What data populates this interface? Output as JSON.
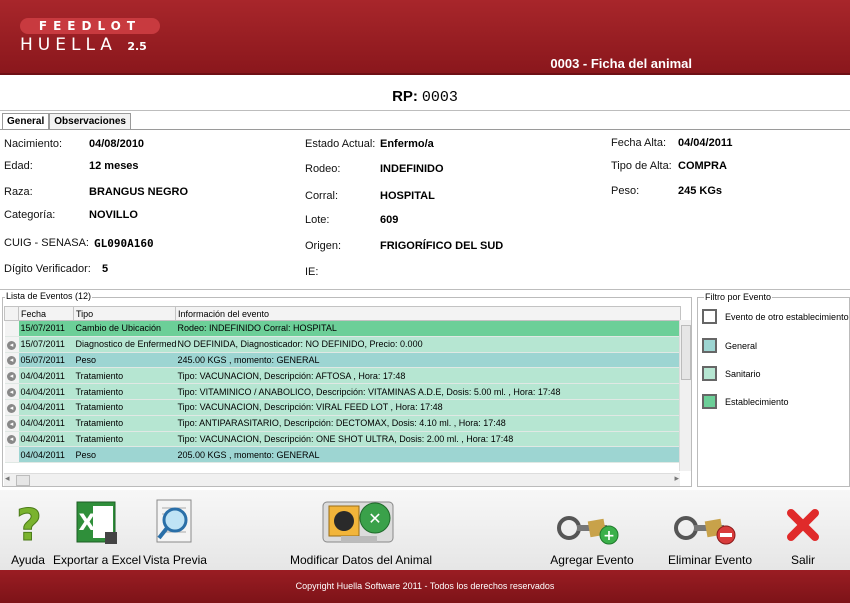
{
  "app": {
    "logo_top": "FEEDLOT",
    "logo_bottom": "HUELLA",
    "logo_version": "2.5",
    "window_title": "0003  -  Ficha del animal"
  },
  "rp": {
    "label": "RP:",
    "value": "0003"
  },
  "tabs": [
    {
      "label": "General",
      "active": true
    },
    {
      "label": "Observaciones",
      "active": false
    }
  ],
  "general": {
    "nacimiento": {
      "label": "Nacimiento:",
      "value": "04/08/2010"
    },
    "edad": {
      "label": "Edad:",
      "value": "12 meses"
    },
    "raza": {
      "label": "Raza:",
      "value": "BRANGUS NEGRO"
    },
    "categoria": {
      "label": "Categoría:",
      "value": "NOVILLO"
    },
    "cuig": {
      "label": "CUIG - SENASA:",
      "value": "GL090A160"
    },
    "digito": {
      "label": "Dígito Verificador:",
      "value": "5"
    },
    "estado": {
      "label": "Estado Actual:",
      "value": "Enfermo/a"
    },
    "rodeo": {
      "label": "Rodeo:",
      "value": "INDEFINIDO"
    },
    "corral": {
      "label": "Corral:",
      "value": "HOSPITAL"
    },
    "lote": {
      "label": "Lote:",
      "value": "609"
    },
    "origen": {
      "label": "Origen:",
      "value": "FRIGORÍFICO DEL SUD"
    },
    "ie": {
      "label": "IE:",
      "value": ""
    },
    "fecha_alta": {
      "label": "Fecha Alta:",
      "value": "04/04/2011"
    },
    "tipo_alta": {
      "label": "Tipo de Alta:",
      "value": "COMPRA"
    },
    "peso": {
      "label": "Peso:",
      "value": "245 KGs"
    }
  },
  "events": {
    "title": "Lista de Eventos (12)",
    "columns": [
      "Fecha",
      "Tipo",
      "Información del evento"
    ],
    "rows": [
      {
        "fecha": "15/07/2011",
        "tipo": "Cambio de Ubicación",
        "info": "Rodeo: INDEFINIDO Corral: HOSPITAL",
        "style": "g1",
        "icon": false
      },
      {
        "fecha": "15/07/2011",
        "tipo": "Diagnostico de Enfermed",
        "info": "NO DEFINIDA, Diagnosticador: NO DEFINIDO, Precio: 0.000",
        "style": "g2",
        "icon": true
      },
      {
        "fecha": "05/07/2011",
        "tipo": "Peso",
        "info": "245.00 KGS , momento: GENERAL",
        "style": "g3",
        "icon": true
      },
      {
        "fecha": "04/04/2011",
        "tipo": "Tratamiento",
        "info": "Tipo: VACUNACION,  Descripción: AFTOSA , Hora: 17:48",
        "style": "g2",
        "icon": true
      },
      {
        "fecha": "04/04/2011",
        "tipo": "Tratamiento",
        "info": "Tipo: VITAMINICO / ANABOLICO,  Descripción: VITAMINAS A.D.E, Dosis: 5.00 ml. , Hora: 17:48",
        "style": "g2",
        "icon": true
      },
      {
        "fecha": "04/04/2011",
        "tipo": "Tratamiento",
        "info": "Tipo: VACUNACION,  Descripción: VIRAL FEED LOT , Hora: 17:48",
        "style": "g2",
        "icon": true
      },
      {
        "fecha": "04/04/2011",
        "tipo": "Tratamiento",
        "info": "Tipo: ANTIPARASITARIO,  Descripción: DECTOMAX, Dosis: 4.10 ml. , Hora: 17:48",
        "style": "g2",
        "icon": true
      },
      {
        "fecha": "04/04/2011",
        "tipo": "Tratamiento",
        "info": "Tipo: VACUNACION,  Descripción: ONE SHOT ULTRA, Dosis: 2.00 ml. , Hora: 17:48",
        "style": "g2",
        "icon": true
      },
      {
        "fecha": "04/04/2011",
        "tipo": "Peso",
        "info": "205.00 KGS , momento: GENERAL",
        "style": "g3",
        "icon": false
      }
    ]
  },
  "filter": {
    "title": "Filtro por Evento",
    "items": [
      {
        "label": "Evento de otro establecimiento",
        "color": "#ffffff"
      },
      {
        "label": "General",
        "color": "#9dd5d2"
      },
      {
        "label": "Sanitario",
        "color": "#b6e6d2"
      },
      {
        "label": "Establecimiento",
        "color": "#6ccf98"
      }
    ]
  },
  "toolbar": {
    "ayuda": "Ayuda",
    "exportar": "Exportar a Excel",
    "vista": "Vista Previa",
    "modificar": "Modificar Datos del Animal",
    "agregar": "Agregar Evento",
    "eliminar": "Eliminar Evento",
    "salir": "Salir"
  },
  "footer": "Copyright Huella Software 2011 - Todos los derechos reservados"
}
